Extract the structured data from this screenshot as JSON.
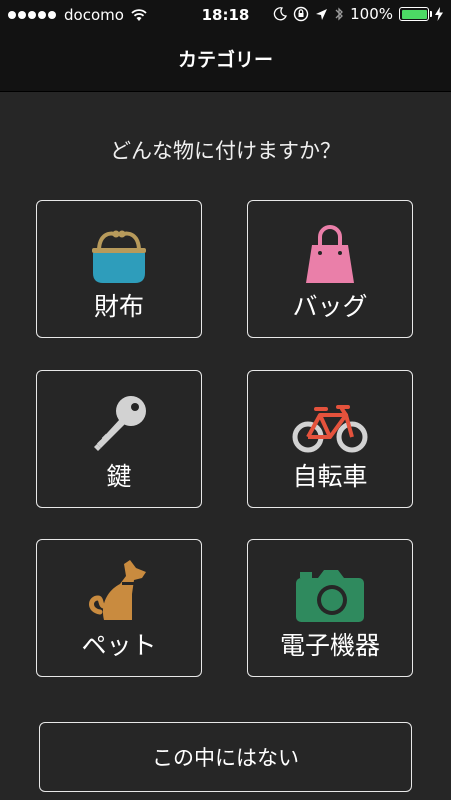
{
  "status_bar": {
    "carrier": "docomo",
    "time": "18:18",
    "battery_percent": "100%",
    "signal_bars": 5,
    "icons": [
      "wifi-icon",
      "moon-icon",
      "rotation-lock-icon",
      "location-icon",
      "bluetooth-icon",
      "battery-icon",
      "charging-icon"
    ],
    "battery_color": "#4cd964"
  },
  "nav": {
    "title": "カテゴリー"
  },
  "prompt": "どんな物に付けますか？",
  "categories": [
    {
      "label": "財布",
      "icon": "wallet-icon",
      "color": "#2e9dbb"
    },
    {
      "label": "バッグ",
      "icon": "bag-icon",
      "color": "#ea7fa9"
    },
    {
      "label": "鍵",
      "icon": "key-icon",
      "color": "#d2d2d2"
    },
    {
      "label": "自転車",
      "icon": "bicycle-icon",
      "color": "#e4523c"
    },
    {
      "label": "ペット",
      "icon": "dog-icon",
      "color": "#c98b3f"
    },
    {
      "label": "電子機器",
      "icon": "camera-icon",
      "color": "#2f8a5e"
    }
  ],
  "none_button": {
    "label": "この中にはない"
  },
  "colors": {
    "background": "#262626",
    "bar_background": "#121212",
    "border": "#e8e8e8"
  }
}
